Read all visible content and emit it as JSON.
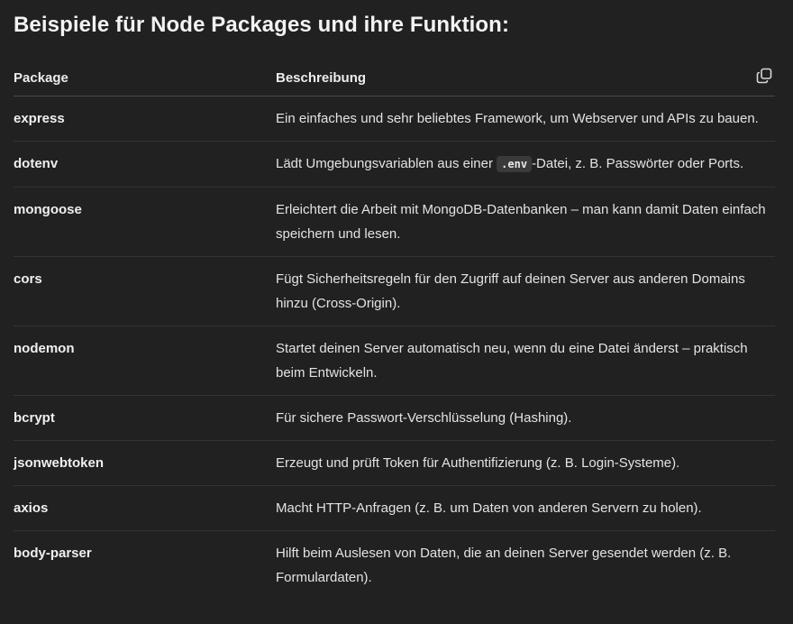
{
  "heading": "Beispiele für Node Packages und ihre Funktion:",
  "table": {
    "headers": [
      "Package",
      "Beschreibung"
    ],
    "copy_icon": "copy-icon",
    "rows": [
      {
        "package": "express",
        "desc": "Ein einfaches und sehr beliebtes Framework, um Webserver und APIs zu bauen."
      },
      {
        "package": "dotenv",
        "desc_before": "Lädt Umgebungsvariablen aus einer ",
        "desc_code": ".env",
        "desc_after": "-Datei, z. B. Passwörter oder Ports."
      },
      {
        "package": "mongoose",
        "desc": "Erleichtert die Arbeit mit MongoDB-Datenbanken – man kann damit Daten einfach speichern und lesen."
      },
      {
        "package": "cors",
        "desc": "Fügt Sicherheitsregeln für den Zugriff auf deinen Server aus anderen Domains hinzu (Cross-Origin)."
      },
      {
        "package": "nodemon",
        "desc": "Startet deinen Server automatisch neu, wenn du eine Datei änderst – praktisch beim Entwickeln."
      },
      {
        "package": "bcrypt",
        "desc": "Für sichere Passwort-Verschlüsselung (Hashing)."
      },
      {
        "package": "jsonwebtoken",
        "desc": "Erzeugt und prüft Token für Authentifizierung (z. B. Login-Systeme)."
      },
      {
        "package": "axios",
        "desc": "Macht HTTP-Anfragen (z. B. um Daten von anderen Servern zu holen)."
      },
      {
        "package": "body-parser",
        "desc": "Hilft beim Auslesen von Daten, die an deinen Server gesendet werden (z. B. Formulardaten)."
      }
    ]
  },
  "colors": {
    "background": "#212121",
    "text": "#ececec",
    "code_bg": "#3a3a3a"
  }
}
